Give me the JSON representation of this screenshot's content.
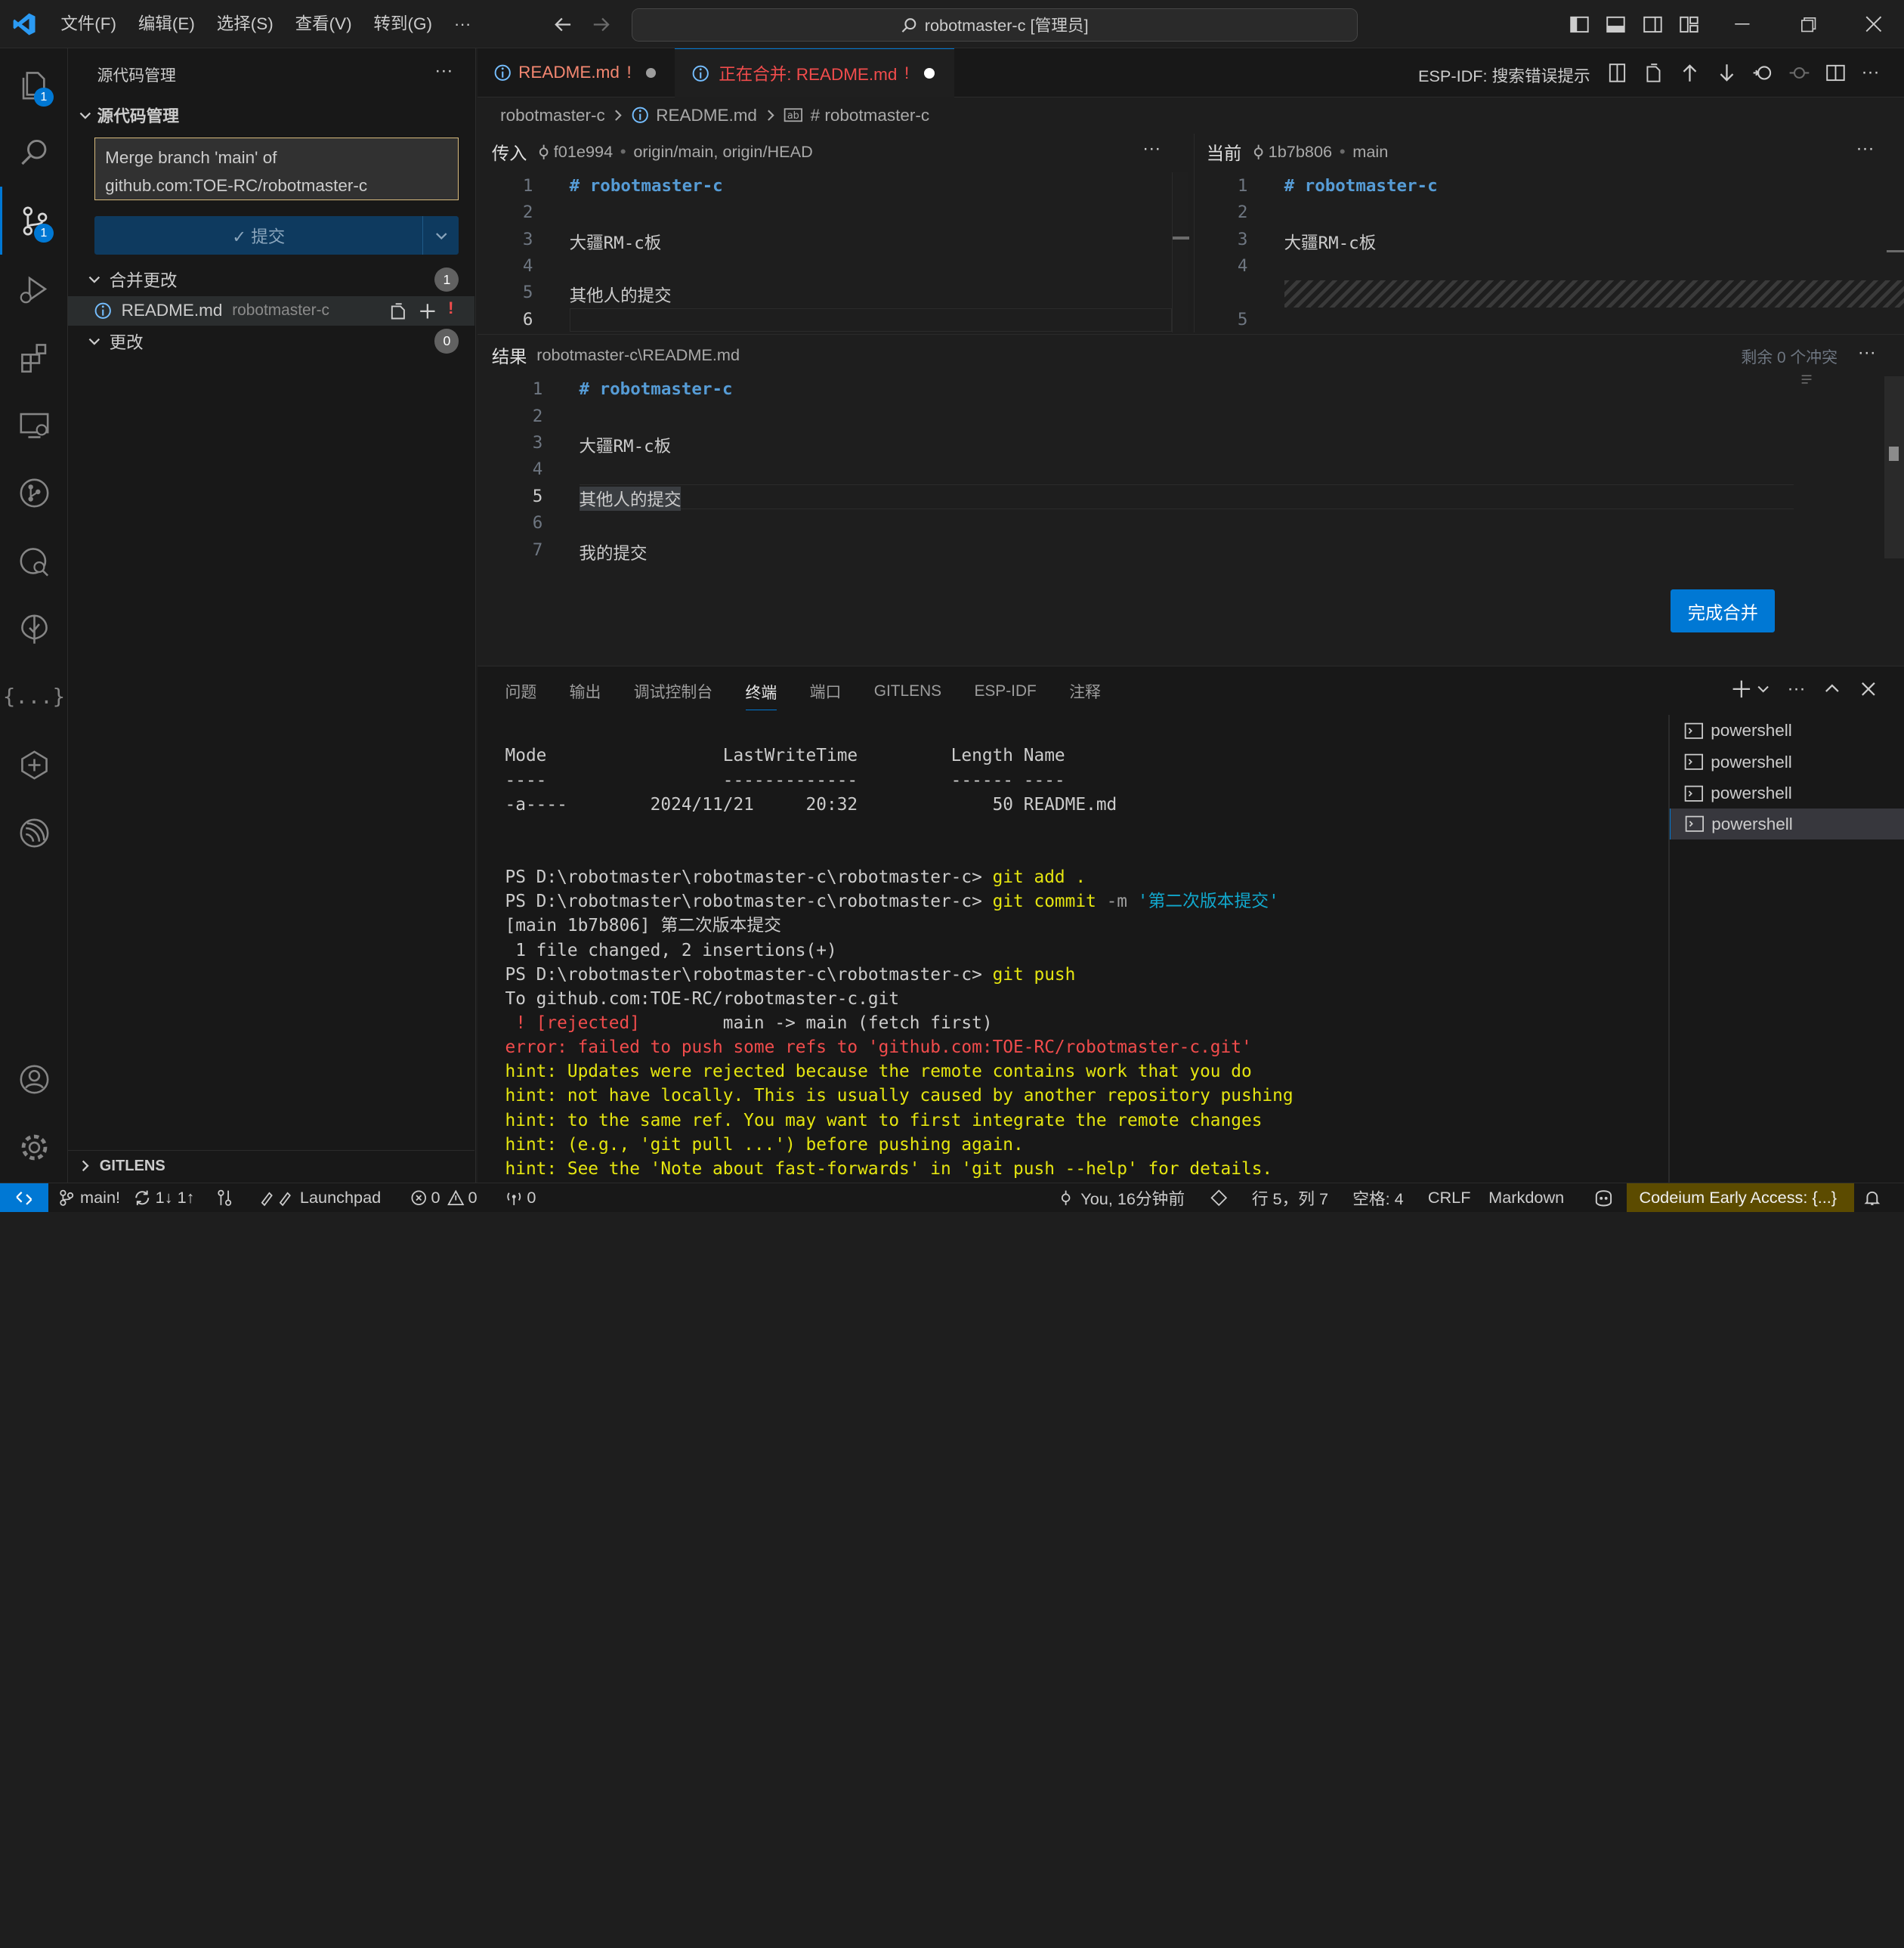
{
  "title": {
    "menu": [
      "文件(F)",
      "编辑(E)",
      "选择(S)",
      "查看(V)",
      "转到(G)",
      "···"
    ],
    "command_center": "robotmaster-c [管理员]"
  },
  "activity": {
    "explorer_badge": "1",
    "scm_badge": "1",
    "extensions_label": "{...}"
  },
  "sidebar": {
    "title": "源代码管理",
    "more": "···",
    "section": "源代码管理",
    "commit_message_line1": "Merge branch 'main' of",
    "commit_message_line2": "github.com:TOE-RC/robotmaster-c",
    "commit_button": "✓ 提交",
    "merge_group": {
      "label": "合并更改",
      "count": "1"
    },
    "merge_file": {
      "name": "README.md",
      "path": "robotmaster-c",
      "status": "!"
    },
    "changes_group": {
      "label": "更改",
      "count": "0"
    },
    "gitlens": "GITLENS"
  },
  "tabs": [
    {
      "label": "README.md",
      "marker": "!"
    },
    {
      "label": "正在合并: README.md",
      "marker": "!"
    }
  ],
  "editor_actions": {
    "esp_label": "ESP-IDF:  搜索错误提示"
  },
  "breadcrumb": {
    "root": "robotmaster-c",
    "file": "README.md",
    "symbol": "# robotmaster-c"
  },
  "incoming": {
    "label": "传入",
    "commit": "f01e994",
    "refs": "origin/main, origin/HEAD",
    "line_numbers": [
      "1",
      "2",
      "3",
      "4",
      "5",
      "6"
    ],
    "lines": [
      "# robotmaster-c",
      "",
      "大疆RM-c板",
      "",
      "其他人的提交",
      ""
    ]
  },
  "current": {
    "label": "当前",
    "commit": "1b7b806",
    "refs": "main",
    "line_numbers": [
      "1",
      "2",
      "3",
      "4",
      "5"
    ],
    "lines": [
      "# robotmaster-c",
      "",
      "大疆RM-c板",
      ""
    ]
  },
  "result": {
    "label": "结果",
    "path": "robotmaster-c\\README.md",
    "conflicts_left": "剩余 0 个冲突",
    "line_numbers": [
      "1",
      "2",
      "3",
      "4",
      "5",
      "6",
      "7"
    ],
    "lines": [
      "# robotmaster-c",
      "",
      "大疆RM-c板",
      "",
      "其他人的提交",
      "",
      "我的提交"
    ],
    "complete_button": "完成合并"
  },
  "panel": {
    "tabs": [
      "问题",
      "输出",
      "调试控制台",
      "终端",
      "端口",
      "GITLENS",
      "ESP-IDF",
      "注释"
    ],
    "active_tab": "终端",
    "terminal": {
      "header": "Mode                 LastWriteTime         Length Name",
      "divider": "----                 -------------         ------ ----",
      "file_row": "-a----        2024/11/21     20:32             50 README.md",
      "prompt": "PS D:\\robotmaster\\robotmaster-c\\robotmaster-c> ",
      "cmd_add": "git add .",
      "cmd_commit_git": "git commit ",
      "cmd_commit_flag": "-m ",
      "cmd_commit_msg": "'第二次版本提交'",
      "commit_result": "[main 1b7b806] 第二次版本提交",
      "commit_stats": " 1 file changed, 2 insertions(+)",
      "cmd_push": "git push",
      "push_to": "To github.com:TOE-RC/robotmaster-c.git",
      "rejected_tag": " ! [rejected]",
      "rejected_rest": "        main -> main (fetch first)",
      "error": "error: failed to push some refs to 'github.com:TOE-RC/robotmaster-c.git'",
      "hints": [
        "hint: Updates were rejected because the remote contains work that you do",
        "hint: not have locally. This is usually caused by another repository pushing",
        "hint: to the same ref. You may want to first integrate the remote changes",
        "hint: (e.g., 'git pull ...') before pushing again.",
        "hint: See the 'Note about fast-forwards' in 'git push --help' for details."
      ]
    },
    "shells": [
      "powershell",
      "powershell",
      "powershell",
      "powershell"
    ]
  },
  "status": {
    "branch": "main!",
    "sync": "1↓ 1↑",
    "launchpad": "Launchpad",
    "errors": "0",
    "warnings": "0",
    "ports": "0",
    "blame": "You, 16分钟前",
    "position": "行 5，列 7",
    "spaces": "空格: 4",
    "eol": "CRLF",
    "language": "Markdown",
    "codeium": "Codeium Early Access: {...}"
  },
  "colors": {
    "accent": "#0078d4",
    "conflict_tab": "#f14c4c",
    "warning_yellow": "#cca700"
  }
}
